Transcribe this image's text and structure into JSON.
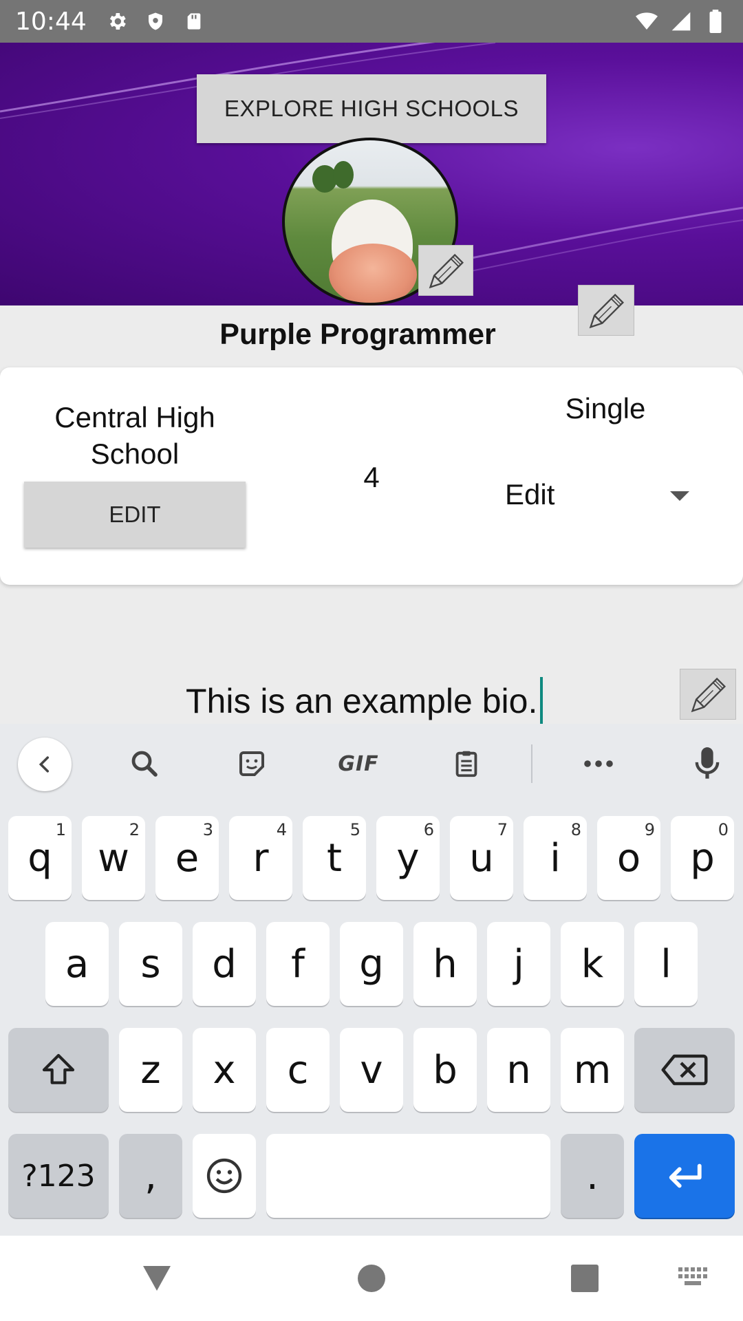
{
  "status_bar": {
    "time": "10:44",
    "left_icons": [
      "gear-icon",
      "shield-icon",
      "sd-card-icon"
    ],
    "right_icons": [
      "wifi-icon",
      "signal-icon",
      "battery-icon"
    ]
  },
  "header": {
    "explore_button_label": "EXPLORE HIGH SCHOOLS",
    "banner_color": "#5a0f9a"
  },
  "profile": {
    "name": "Purple Programmer",
    "school": "Central High School",
    "school_edit_label": "EDIT",
    "grade": "4",
    "relationship_status": "Single",
    "status_dropdown_value": "Edit",
    "bio": "This is an example bio."
  },
  "keyboard": {
    "toolbar": [
      "back-icon",
      "search-icon",
      "sticker-icon",
      "gif-icon",
      "clipboard-icon",
      "more-icon",
      "mic-icon"
    ],
    "gif_label": "GIF",
    "row1": [
      {
        "k": "q",
        "h": "1"
      },
      {
        "k": "w",
        "h": "2"
      },
      {
        "k": "e",
        "h": "3"
      },
      {
        "k": "r",
        "h": "4"
      },
      {
        "k": "t",
        "h": "5"
      },
      {
        "k": "y",
        "h": "6"
      },
      {
        "k": "u",
        "h": "7"
      },
      {
        "k": "i",
        "h": "8"
      },
      {
        "k": "o",
        "h": "9"
      },
      {
        "k": "p",
        "h": "0"
      }
    ],
    "row2": [
      "a",
      "s",
      "d",
      "f",
      "g",
      "h",
      "j",
      "k",
      "l"
    ],
    "row3": [
      "z",
      "x",
      "c",
      "v",
      "b",
      "n",
      "m"
    ],
    "symbols_label": "?123",
    "comma": ",",
    "period": ".",
    "accent_color": "#1a73e8"
  },
  "nav_bar": {
    "icons": [
      "back-triangle-icon",
      "home-circle-icon",
      "recents-square-icon",
      "keyboard-switch-icon"
    ]
  }
}
